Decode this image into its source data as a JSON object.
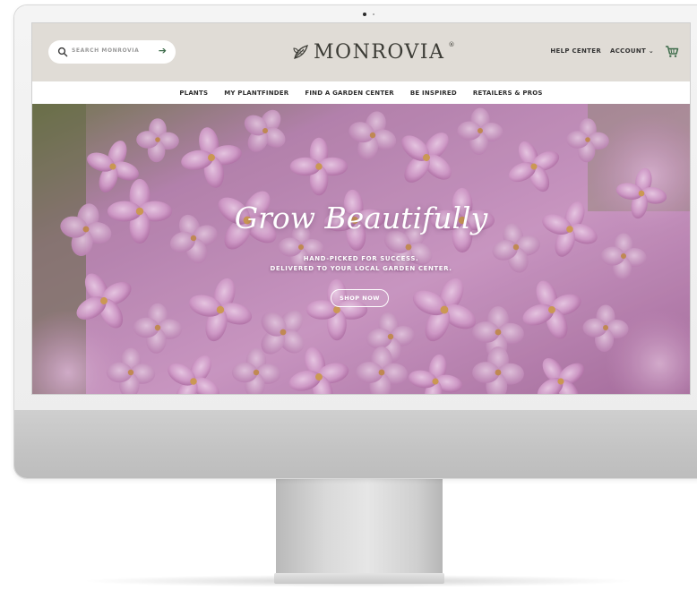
{
  "header": {
    "search": {
      "placeholder": "SEARCH MONROVIA",
      "icon": "search-icon",
      "submit_icon": "arrow-right-icon"
    },
    "logo": {
      "text": "MONROVIA",
      "reg": "®"
    },
    "links": {
      "help": "HELP CENTER",
      "account": "ACCOUNT ⌄"
    },
    "cart_icon": "cart-icon"
  },
  "nav": {
    "items": [
      "PLANTS",
      "MY PLANTFINDER",
      "FIND A GARDEN CENTER",
      "BE INSPIRED",
      "RETAILERS & PROS"
    ]
  },
  "hero": {
    "title": "Grow Beautifully",
    "subtitle_line1": "HAND-PICKED FOR SUCCESS.",
    "subtitle_line2": "DELIVERED TO YOUR LOCAL GARDEN CENTER.",
    "button": "SHOP NOW"
  },
  "colors": {
    "header_bg": "#e0dcd6",
    "brand_green": "#3d6b4a",
    "lilac": "#c98fc0"
  }
}
